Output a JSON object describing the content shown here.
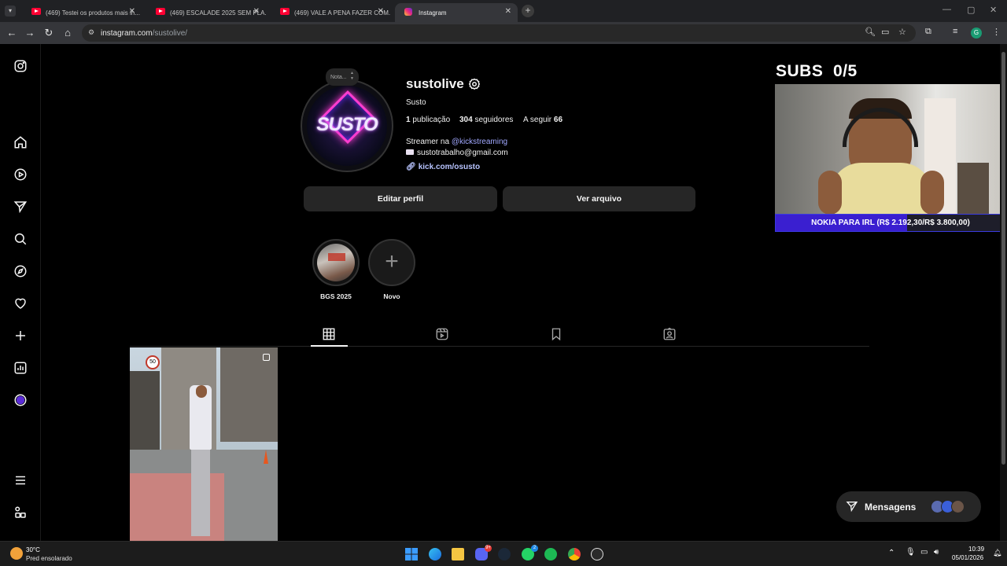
{
  "browser": {
    "tabs": [
      {
        "title": "(469) Testei os produtos mais in...",
        "active": false
      },
      {
        "title": "(469) ESCALADE 2025 SEM PLA...",
        "active": false
      },
      {
        "title": "(469) VALE A PENA FAZER COM...",
        "active": false
      },
      {
        "title": "Instagram",
        "active": true
      }
    ],
    "url_host": "instagram.com",
    "url_path": "/sustolive/",
    "profile_initial": "G"
  },
  "profile": {
    "note_label": "Nota...",
    "avatar_text": "SUSTO",
    "username": "sustolive",
    "full_name": "Susto",
    "posts_count": "1",
    "posts_label": "publicação",
    "followers_count": "304",
    "followers_label": "seguidores",
    "following_label": "A seguir",
    "following_count": "66",
    "bio_prefix": "Streamer na",
    "bio_mention": "@kickstreaming",
    "bio_email": "sustotrabalho@gmail.com",
    "bio_link": "kick.com/osusto",
    "edit_button": "Editar perfil",
    "archive_button": "Ver arquivo",
    "highlights": [
      {
        "label": "BGS 2025"
      },
      {
        "label": "Novo"
      }
    ]
  },
  "overlay": {
    "subs_label": "SUBS",
    "subs_value": "0/5",
    "goal_text": "NOKIA PARA IRL (R$ 2.192,30/R$ 3.800,00)",
    "goal_fraction": 0.577
  },
  "messages": {
    "label": "Mensagens"
  },
  "taskbar": {
    "temperature": "30°C",
    "weather": "Pred ensolarado",
    "time": "10:39",
    "date": "05/01/2026",
    "discord_badge": "9+",
    "whatsapp_badge": "2"
  },
  "colors": {
    "mention": "#a1a8ff",
    "link": "#b8c4ff",
    "goal_fill": "#3a1fd0"
  }
}
